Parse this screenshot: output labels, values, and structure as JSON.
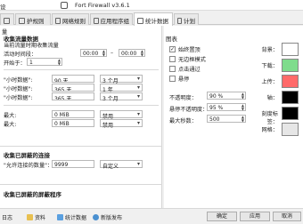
{
  "window": {
    "title": "Fort Firewall v3.6.1",
    "left_label": "设"
  },
  "tabs": [
    {
      "label": "",
      "icon": "tab-icon"
    },
    {
      "label": "护规则",
      "icon": "tab-icon"
    },
    {
      "label": "网络规则",
      "icon": "tab-icon"
    },
    {
      "label": "应用程序组",
      "icon": "tab-icon"
    },
    {
      "label": "统计数据",
      "icon": "chart-icon"
    },
    {
      "label": "计划",
      "icon": "calendar-icon"
    }
  ],
  "left": {
    "section1_heading": "收集流量数据",
    "top_label": "量",
    "collect_current_label": "当前流量时期收集流量",
    "active_period_label": "活动时间段：",
    "time_from": "00:00",
    "time_to": "00:00",
    "dash": "–",
    "hour_label": "开始于：",
    "hour_value": "1",
    "rows": [
      {
        "label": "\"小时数据\":",
        "a": "90 天",
        "b": "3 个月"
      },
      {
        "label": "\"小时数据\":",
        "a": "365 天",
        "b": "1 年"
      },
      {
        "label": "\"小时数据\":",
        "a": "365 天",
        "b": "3 个月"
      }
    ],
    "limit_rows": [
      {
        "label": "最大:",
        "a": "0 MiB",
        "b": "禁用"
      },
      {
        "label": "最大:",
        "a": "0 MiB",
        "b": "禁用"
      }
    ],
    "section2_heading": "收集已屏蔽的连接",
    "blocked_label": "\"允许连接的数量\"：",
    "blocked_value": "9999",
    "blocked_combo": "自定义",
    "section3_heading": "收集已屏蔽的屏蔽程序"
  },
  "right": {
    "heading": "图表",
    "checkboxes": [
      {
        "label": "始终置顶",
        "checked": true
      },
      {
        "label": "无边框模式",
        "checked": false
      },
      {
        "label": "点击通过",
        "checked": false
      },
      {
        "label": "悬停",
        "checked": false
      }
    ],
    "opacity_label": "不透明度：",
    "opacity_value": "90 %",
    "hover_opacity_label": "悬停不透明度：",
    "hover_opacity_value": "95 %",
    "max_seconds_label": "最大秒数：",
    "max_seconds_value": "500",
    "colors": [
      {
        "label": "背景：",
        "color": "#ffffff"
      },
      {
        "label": "下载：",
        "color": "#7fdc8c"
      },
      {
        "label": "上传：",
        "color": "#ff6a6a"
      },
      {
        "label": "轴：",
        "color": "#000000"
      },
      {
        "label": "刻度标签：",
        "color": "#000000"
      },
      {
        "label": "网格：",
        "color": "#e6e6e6"
      }
    ]
  },
  "statusbar": {
    "log": "日志",
    "data": "资料",
    "stats": "统计数据",
    "release": "新版发布",
    "ok": "确定",
    "apply": "应用",
    "cancel": "取消"
  },
  "colors": {
    "download": "#7fdc8c",
    "upload": "#ff6a6a"
  }
}
